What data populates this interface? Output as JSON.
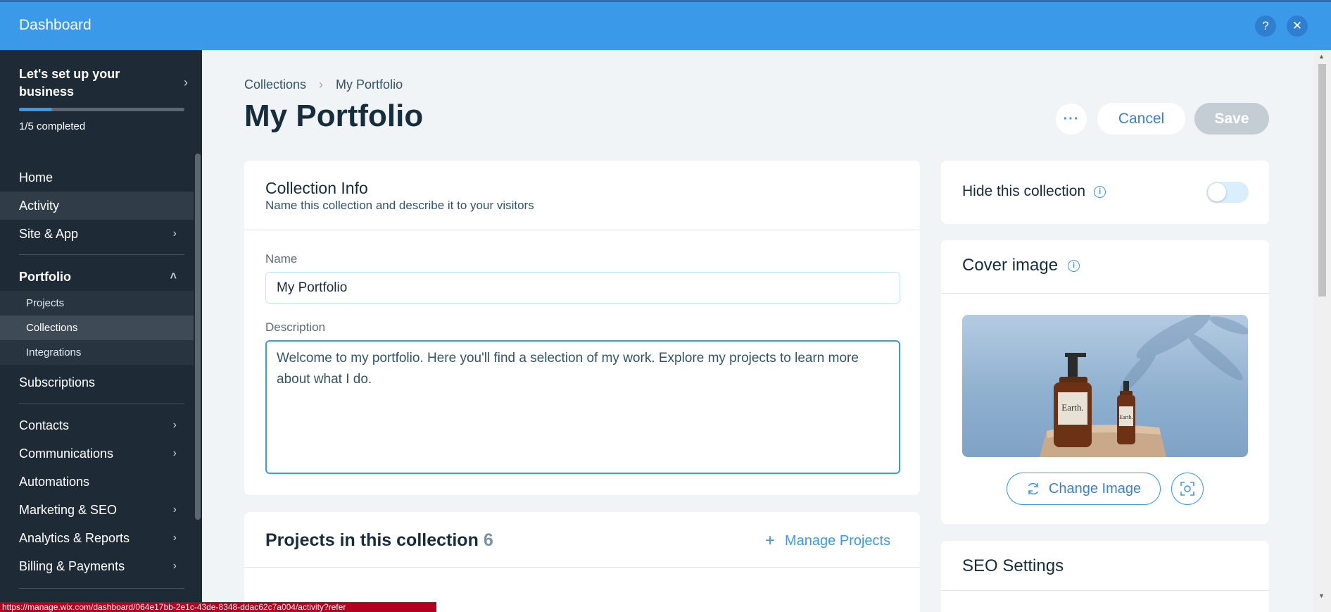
{
  "topbar": {
    "title": "Dashboard",
    "help": "?",
    "close": "✕"
  },
  "sidebar": {
    "setup_title": "Let's set up your business",
    "progress_fraction": 0.2,
    "completed_text": "1/5 completed",
    "items": {
      "home": "Home",
      "activity": "Activity",
      "site_app": "Site & App",
      "portfolio": "Portfolio",
      "projects": "Projects",
      "collections": "Collections",
      "integrations": "Integrations",
      "subscriptions": "Subscriptions",
      "contacts": "Contacts",
      "communications": "Communications",
      "automations": "Automations",
      "marketing": "Marketing & SEO",
      "analytics": "Analytics & Reports",
      "billing": "Billing & Payments"
    }
  },
  "breadcrumb": {
    "parent": "Collections",
    "current": "My Portfolio"
  },
  "page": {
    "title": "My Portfolio",
    "more": "···",
    "cancel": "Cancel",
    "save": "Save"
  },
  "collection_info": {
    "title": "Collection Info",
    "subtitle": "Name this collection and describe it to your visitors",
    "name_label": "Name",
    "name_value": "My Portfolio",
    "description_label": "Description",
    "description_value": "Welcome to my portfolio. Here you'll find a selection of my work. Explore my projects to learn more about what I do."
  },
  "projects": {
    "title": "Projects in this collection",
    "count": "6",
    "manage": "Manage Projects"
  },
  "right_panel": {
    "hide_label": "Hide this collection",
    "hide_enabled": false,
    "cover_title": "Cover image",
    "change_image": "Change Image",
    "seo_title": "SEO Settings",
    "bottle_label_large": "Earth.",
    "bottle_label_small": "Earth."
  },
  "statusbar": {
    "url": "https://manage.wix.com/dashboard/064e17bb-2e1c-43de-8348-ddac62c7a004/activity?refer"
  },
  "colors": {
    "accent": "#3b99e9",
    "sidebar": "#1e2a35",
    "save_disabled": "#c4ccd4"
  }
}
